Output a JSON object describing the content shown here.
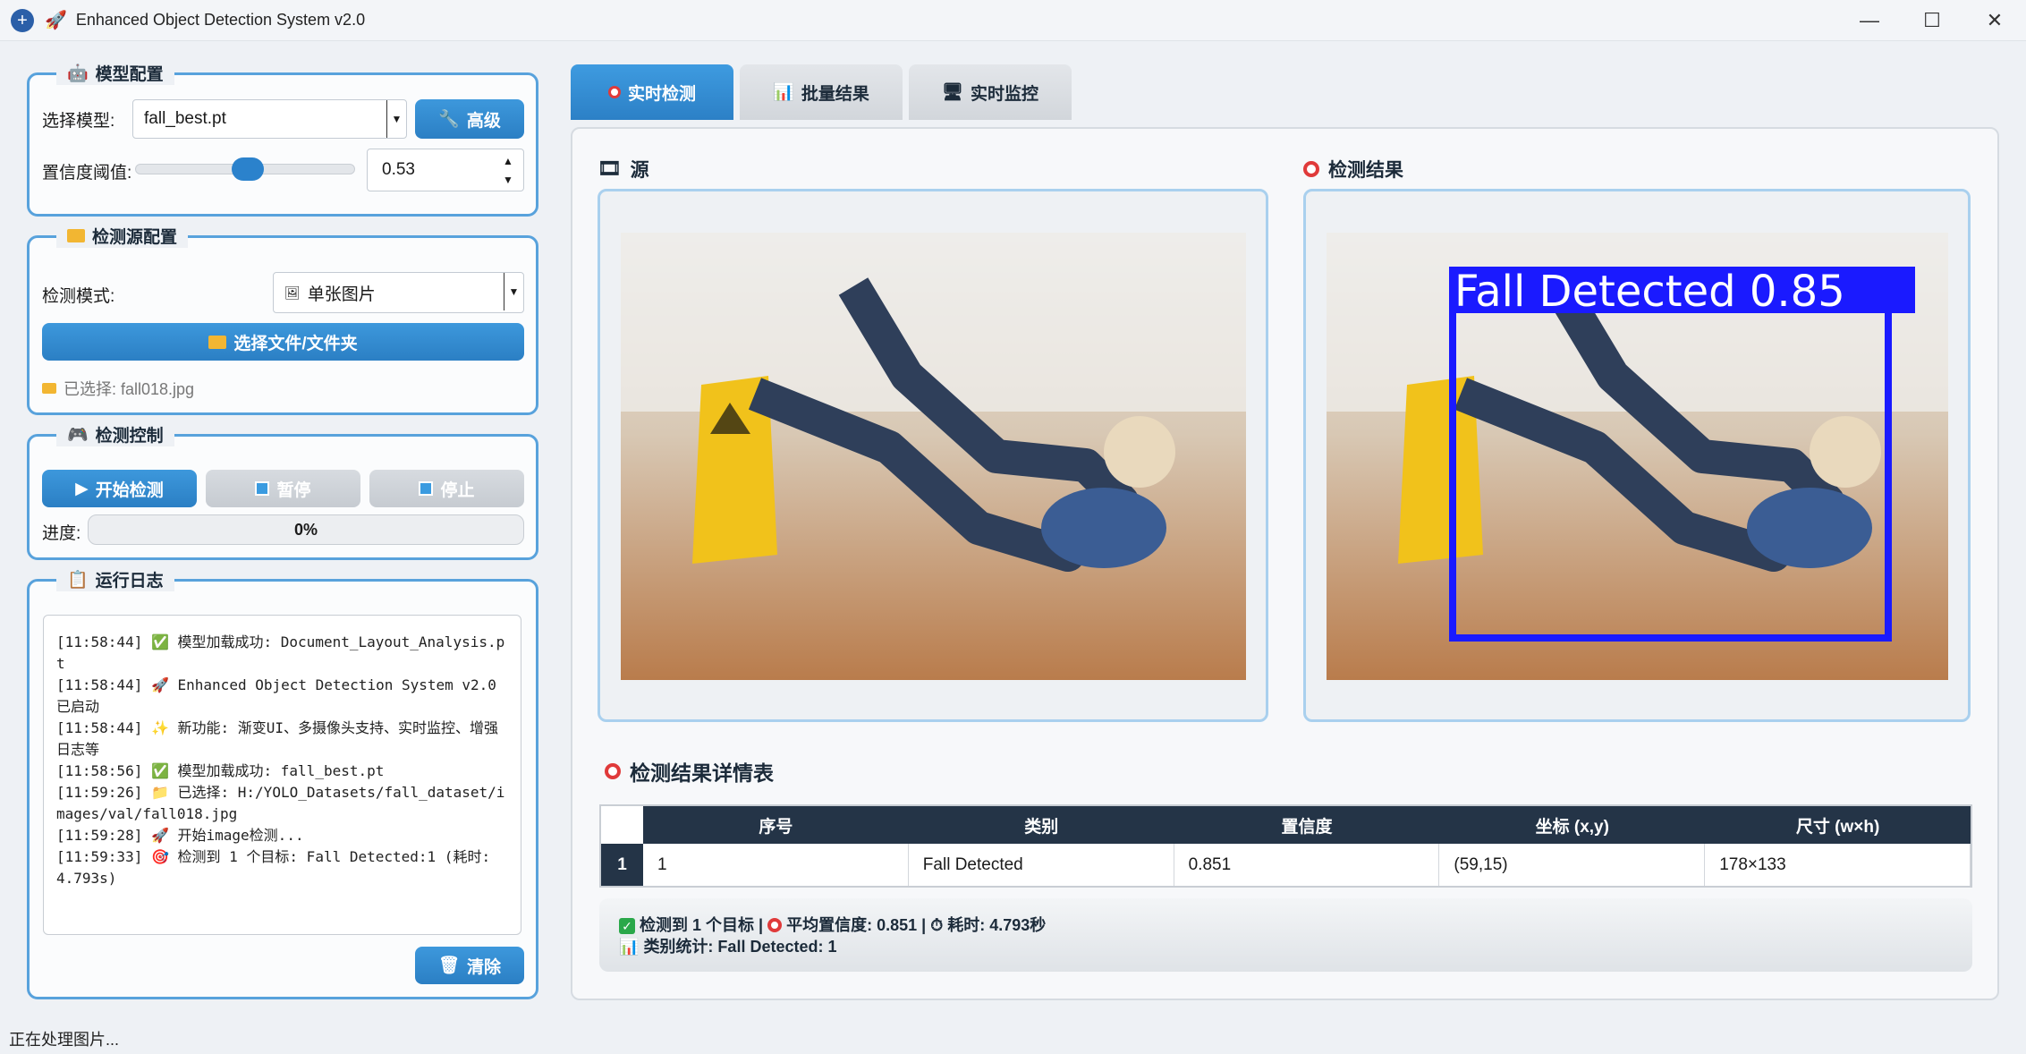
{
  "window": {
    "title": "Enhanced Object Detection System v2.0",
    "minimize": "—",
    "maximize": "☐",
    "close": "✕"
  },
  "model_config": {
    "title": "模型配置",
    "model_label": "选择模型:",
    "model_value": "fall_best.pt",
    "advanced_button": "高级",
    "conf_label": "置信度阈值:",
    "conf_value": "0.53"
  },
  "source_config": {
    "title": "检测源配置",
    "mode_label": "检测模式:",
    "mode_value": "单张图片",
    "select_button": "选择文件/文件夹",
    "selected_text": "已选择: fall018.jpg"
  },
  "control": {
    "title": "检测控制",
    "start_button": "开始检测",
    "pause_button": "暂停",
    "stop_button": "停止",
    "progress_label": "进度:",
    "progress_text": "0%",
    "progress_fraction": 0
  },
  "log": {
    "title": "运行日志",
    "lines": [
      "[11:58:44] ✅ 模型加载成功: Document_Layout_Analysis.pt",
      "[11:58:44] 🚀 Enhanced Object Detection System v2.0 已启动",
      "[11:58:44] ✨ 新功能: 渐变UI、多摄像头支持、实时监控、增强日志等",
      "[11:58:56] ✅ 模型加载成功: fall_best.pt",
      "[11:59:26] 📁 已选择: H:/YOLO_Datasets/fall_dataset/images/val/fall018.jpg",
      "[11:59:28] 🚀 开始image检测...",
      "[11:59:33] 🎯 检测到 1 个目标: Fall Detected:1 (耗时: 4.793s)"
    ],
    "clear_button": "清除"
  },
  "tabs": [
    "实时检测",
    "批量结果",
    "实时监控"
  ],
  "source_panel": {
    "title": "源"
  },
  "result_panel": {
    "title": "检测结果",
    "box_label": "Fall Detected 0.85"
  },
  "details": {
    "title": "检测结果详情表",
    "columns": [
      "序号",
      "类别",
      "置信度",
      "坐标 (x,y)",
      "尺寸 (w×h)"
    ],
    "rows": [
      {
        "row_header": "1",
        "cells": [
          "1",
          "Fall Detected",
          "0.851",
          "(59,15)",
          "178×133"
        ]
      }
    ]
  },
  "summary": {
    "line1_a": "检测到 1 个目标 |",
    "line1_b": "平均置信度: 0.851 |",
    "line1_c": "耗时: 4.793秒",
    "line2": "类别统计: Fall Detected: 1"
  },
  "status_bar": "正在处理图片...",
  "colors": {
    "accent": "#2b82cc",
    "header_dark": "#243447",
    "border_blue": "#58a2dc",
    "detect_box": "#1a1aff"
  }
}
